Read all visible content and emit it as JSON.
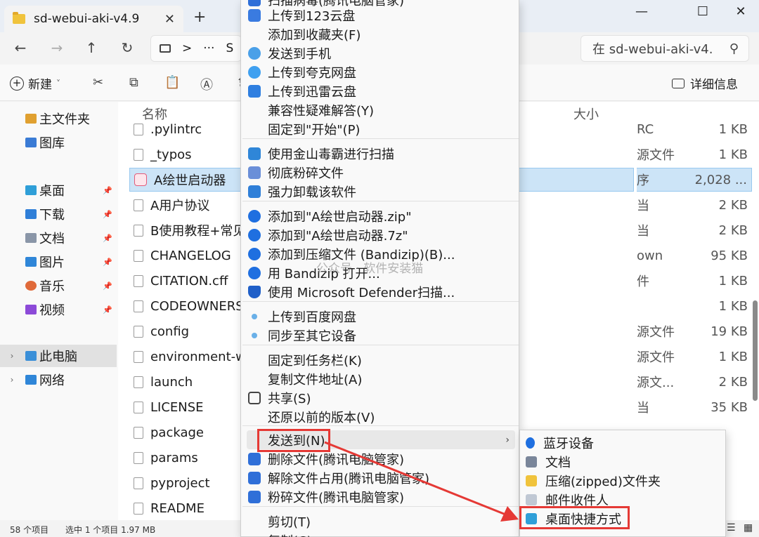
{
  "window": {
    "tab_title": "sd-webui-aki-v4.9",
    "tab_close": "✕",
    "tab_add": "+",
    "minimize": "—",
    "maximize": "☐",
    "close": "✕"
  },
  "nav": {
    "back": "←",
    "forward": "→",
    "up": "↑",
    "refresh": "↻",
    "chevron": ">",
    "more": "···",
    "path_partial": "S",
    "search_placeholder": "在 sd-webui-aki-v4.",
    "search_icon": "⚲"
  },
  "toolbar": {
    "new_label": "新建",
    "new_chevron": "˅",
    "details_label": "详细信息"
  },
  "sidebar": {
    "items": [
      {
        "label": "主文件夹",
        "icon": "home-icon",
        "color": "#e0a030"
      },
      {
        "label": "图库",
        "icon": "gallery-icon",
        "color": "#3a7bd5"
      },
      {
        "label": "桌面",
        "icon": "desktop-icon",
        "color": "#2f9fd8"
      },
      {
        "label": "下载",
        "icon": "download-icon",
        "color": "#2f7fd8"
      },
      {
        "label": "文档",
        "icon": "document-icon",
        "color": "#8a96a8"
      },
      {
        "label": "图片",
        "icon": "picture-icon",
        "color": "#2f86d8"
      },
      {
        "label": "音乐",
        "icon": "music-icon",
        "color": "#e06a3a"
      },
      {
        "label": "视频",
        "icon": "video-icon",
        "color": "#8c4ad8"
      },
      {
        "label": "此电脑",
        "icon": "this-pc-icon",
        "color": "#3a8fd8"
      },
      {
        "label": "网络",
        "icon": "network-icon",
        "color": "#2f86d8"
      }
    ],
    "pin": "📌",
    "chevron": "›"
  },
  "filelist": {
    "col_name": "名称",
    "col_size": "大小",
    "rows": [
      {
        "name": ".pylintrc",
        "type": "RC",
        "size": "1 KB"
      },
      {
        "name": "_typos",
        "type": "源文件",
        "size": "1 KB"
      },
      {
        "name": "A绘世启动器",
        "type": "序",
        "size": "2,028 ..."
      },
      {
        "name": "A用户协议",
        "type": "当",
        "size": "2 KB"
      },
      {
        "name": "B使用教程+常见",
        "type": "当",
        "size": "2 KB"
      },
      {
        "name": "CHANGELOG",
        "type": "own",
        "size": "95 KB"
      },
      {
        "name": "CITATION.cff",
        "type": "件",
        "size": "1 KB"
      },
      {
        "name": "CODEOWNERS",
        "type": "",
        "size": "1 KB"
      },
      {
        "name": "config",
        "type": "源文件",
        "size": "19 KB"
      },
      {
        "name": "environment-w",
        "type": "源文件",
        "size": "1 KB"
      },
      {
        "name": "launch",
        "type": "源文...",
        "size": "2 KB"
      },
      {
        "name": "LICENSE",
        "type": "当",
        "size": "35 KB"
      },
      {
        "name": "package",
        "type": "",
        "size": ""
      },
      {
        "name": "params",
        "type": "",
        "size": ""
      },
      {
        "name": "pyproject",
        "type": "",
        "size": ""
      },
      {
        "name": "README",
        "type": "",
        "size": ""
      }
    ]
  },
  "status": {
    "count": "58 个项目",
    "selected": "选中 1 个项目  1.97 MB"
  },
  "context_menu": {
    "items": [
      {
        "label": "扫描病毒(腾讯电脑管家)",
        "icon": "tencent-scan-icon",
        "color": "#2f6fd8"
      },
      {
        "label": "上传到123云盘",
        "icon": "cloud-123-icon",
        "color": "#3a7be0"
      },
      {
        "label": "添加到收藏夹(F)",
        "icon": "",
        "color": ""
      },
      {
        "label": "发送到手机",
        "icon": "phone-cloud-icon",
        "color": "#4aa0e8"
      },
      {
        "label": "上传到夸克网盘",
        "icon": "quark-icon",
        "color": "#3fa0f0"
      },
      {
        "label": "上传到迅雷云盘",
        "icon": "thunder-icon",
        "color": "#2f7fe0"
      },
      {
        "label": "兼容性疑难解答(Y)",
        "icon": "",
        "color": ""
      },
      {
        "label": "固定到\"开始\"(P)",
        "icon": "",
        "color": ""
      },
      {
        "label": "使用金山毒霸进行扫描",
        "icon": "kingsoft-icon",
        "color": "#2f86d8"
      },
      {
        "label": "彻底粉碎文件",
        "icon": "shred-icon",
        "color": "#6a8fd8"
      },
      {
        "label": "强力卸载该软件",
        "icon": "uninstall-icon",
        "color": "#2f7fd8"
      },
      {
        "label": "添加到\"A绘世启动器.zip\"",
        "icon": "bandizip-icon",
        "color": "#1f6fe0"
      },
      {
        "label": "添加到\"A绘世启动器.7z\"",
        "icon": "bandizip-icon",
        "color": "#1f6fe0"
      },
      {
        "label": "添加到压缩文件 (Bandizip)(B)...",
        "icon": "bandizip-icon",
        "color": "#1f6fe0"
      },
      {
        "label": "用 Bandizip 打开...",
        "icon": "bandizip-icon",
        "color": "#1f6fe0"
      },
      {
        "label": "使用 Microsoft Defender扫描...",
        "icon": "defender-shield-icon",
        "color": "#1f5fc8"
      },
      {
        "label": "上传到百度网盘",
        "icon": "baidu-cloud-icon",
        "color": "#6ab0e8"
      },
      {
        "label": "同步至其它设备",
        "icon": "sync-icon",
        "color": "#6ab0e8"
      },
      {
        "label": "固定到任务栏(K)",
        "icon": "",
        "color": ""
      },
      {
        "label": "复制文件地址(A)",
        "icon": "",
        "color": ""
      },
      {
        "label": "共享(S)",
        "icon": "share-icon",
        "color": "#444444"
      },
      {
        "label": "还原以前的版本(V)",
        "icon": "",
        "color": ""
      },
      {
        "label": "发送到(N)",
        "icon": "",
        "color": ""
      },
      {
        "label": "删除文件(腾讯电脑管家)",
        "icon": "tencent-delete-icon",
        "color": "#2f6fd8"
      },
      {
        "label": "解除文件占用(腾讯电脑管家)",
        "icon": "tencent-unlock-icon",
        "color": "#2f6fd8"
      },
      {
        "label": "粉碎文件(腾讯电脑管家)",
        "icon": "tencent-shred-icon",
        "color": "#2f6fd8"
      },
      {
        "label": "剪切(T)",
        "icon": "",
        "color": ""
      },
      {
        "label": "复制(C)",
        "icon": "",
        "color": ""
      }
    ],
    "submenu_arrow": "›"
  },
  "send_to_submenu": {
    "items": [
      {
        "label": "蓝牙设备",
        "icon": "bluetooth-icon",
        "color": "#1f6fe0"
      },
      {
        "label": "文档",
        "icon": "document-icon",
        "color": "#7a869a"
      },
      {
        "label": "压缩(zipped)文件夹",
        "icon": "zip-folder-icon",
        "color": "#f0c33c"
      },
      {
        "label": "邮件收件人",
        "icon": "mail-icon",
        "color": "#c0c8d4"
      },
      {
        "label": "桌面快捷方式",
        "icon": "desktop-shortcut-icon",
        "color": "#2f9fd8"
      }
    ]
  },
  "watermark": "公众号 · 软件安装猫",
  "colors": {
    "highlight_red": "#e53935",
    "selection_blue": "#cce4f7"
  }
}
